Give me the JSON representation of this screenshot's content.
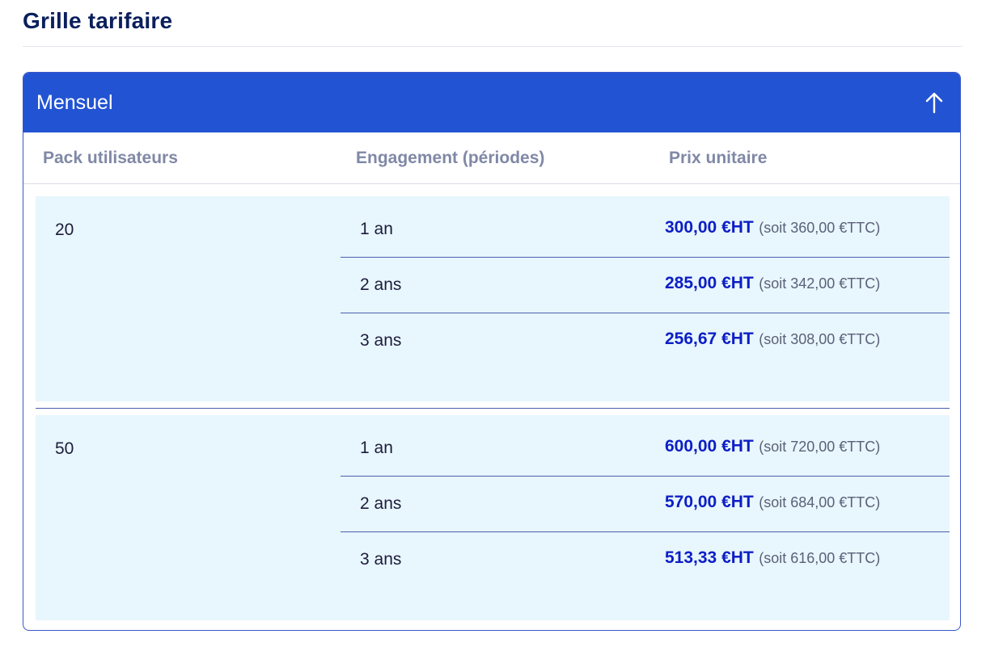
{
  "page": {
    "title": "Grille tarifaire"
  },
  "panel": {
    "title": "Mensuel",
    "collapse_icon": "arrow-up-icon",
    "columns": [
      "Pack utilisateurs",
      "Engagement (périodes)",
      "Prix unitaire"
    ],
    "groups": [
      {
        "pack": "20",
        "rows": [
          {
            "engagement": "1 an",
            "price_ht": "300,00 €HT",
            "price_ttc": "(soit 360,00 €TTC)"
          },
          {
            "engagement": "2 ans",
            "price_ht": "285,00 €HT",
            "price_ttc": "(soit 342,00 €TTC)"
          },
          {
            "engagement": "3 ans",
            "price_ht": "256,67 €HT",
            "price_ttc": "(soit 308,00 €TTC)"
          }
        ]
      },
      {
        "pack": "50",
        "rows": [
          {
            "engagement": "1 an",
            "price_ht": "600,00 €HT",
            "price_ttc": "(soit 720,00 €TTC)"
          },
          {
            "engagement": "2 ans",
            "price_ht": "570,00 €HT",
            "price_ttc": "(soit 684,00 €TTC)"
          },
          {
            "engagement": "3 ans",
            "price_ht": "513,33 €HT",
            "price_ttc": "(soit 616,00 €TTC)"
          }
        ]
      }
    ]
  },
  "colors": {
    "header_bg": "#2253d3",
    "group_bg": "#e8f6fd",
    "price_accent": "#0c1ec4",
    "title": "#0a1f5c"
  }
}
